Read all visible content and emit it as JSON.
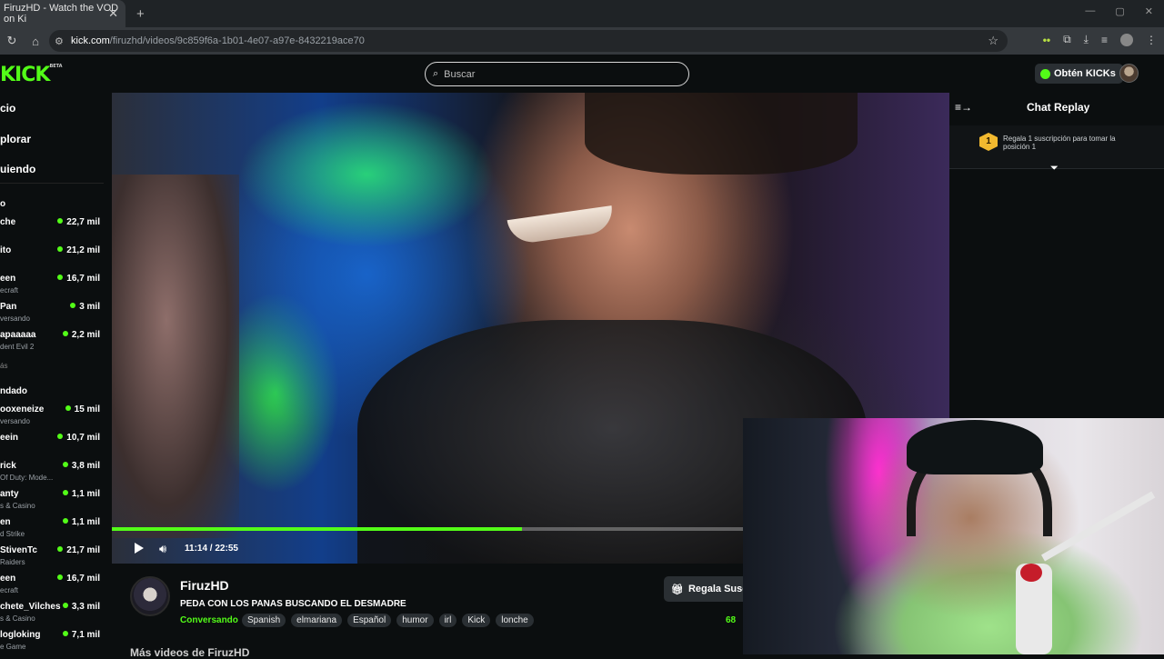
{
  "browser": {
    "tab_title": "FiruzHD - Watch the VOD on Ki",
    "tab_close": "✕",
    "new_tab": "+",
    "url_host": "kick.com",
    "url_path": "/firuzhd/videos/9c859f6a-1b01-4e07-a97e-8432219ace70",
    "window_controls": [
      "—",
      "▢",
      "✕"
    ]
  },
  "header": {
    "logo": "KICK",
    "logo_badge": "BETA",
    "search_placeholder": "Buscar",
    "kicks_button": "Obtén KICKs"
  },
  "sidebar": {
    "nav": [
      "cio",
      "plorar",
      "uiendo"
    ],
    "recommended_head": "o",
    "recommended": [
      {
        "name": "che",
        "category": "",
        "viewers": "22,7 mil"
      },
      {
        "name": "ito",
        "category": "",
        "viewers": "21,2 mil"
      },
      {
        "name": "een",
        "category": "ecraft",
        "viewers": "16,7 mil"
      },
      {
        "name": "Pan",
        "category": "versando",
        "viewers": "3 mil"
      },
      {
        "name": "apaaaaa",
        "category": "dent Evil 2",
        "viewers": "2,2 mil"
      }
    ],
    "recommended_more": "ás",
    "following_head": "ndado",
    "following": [
      {
        "name": "ooxeneize",
        "category": "versando",
        "viewers": "15 mil"
      },
      {
        "name": "eein",
        "category": "",
        "viewers": "10,7 mil"
      },
      {
        "name": "rick",
        "category": "Of Duty: Mode...",
        "viewers": "3,8 mil"
      },
      {
        "name": "anty",
        "category": "s & Casino",
        "viewers": "1,1 mil"
      },
      {
        "name": "en",
        "category": "d Strike",
        "viewers": "1,1 mil"
      },
      {
        "name": "StivenTc",
        "category": "Raiders",
        "viewers": "21,7 mil"
      },
      {
        "name": "een",
        "category": "ecraft",
        "viewers": "16,7 mil"
      },
      {
        "name": "chete_Vilches",
        "category": "s & Casino",
        "viewers": "3,3 mil"
      },
      {
        "name": "logloking",
        "category": "e Game",
        "viewers": "7,1 mil"
      }
    ]
  },
  "player": {
    "current_time": "11:14",
    "duration": "22:55",
    "time_text": "11:14 / 22:55",
    "progress_fraction": 0.49
  },
  "chat": {
    "title": "Chat Replay",
    "gift_rank": "1",
    "gift_text": "Regala 1 suscripción para tomar la posición 1"
  },
  "info": {
    "streamer": "FiruzHD",
    "title": "PEDA CON LOS PANAS BUSCANDO EL DESMADRE",
    "category": "Conversando",
    "tags": [
      "Spanish",
      "elmariana",
      "Español",
      "humor",
      "irl",
      "Kick",
      "lonche"
    ],
    "gift_sub_button": "Regala Susc",
    "followers_partial": "68",
    "more_videos": "Más videos de FiruzHD"
  },
  "icons": {
    "back": "arrow-left",
    "home": "home",
    "search": "search",
    "star": "bookmark-star",
    "play": "play",
    "volume": "volume",
    "chat_collapse": "chat-collapse",
    "filter": "filter",
    "gift": "gift"
  },
  "colors": {
    "accent": "#53fc18",
    "background": "#0b0e0f",
    "gift_badge": "#f2b92f"
  }
}
